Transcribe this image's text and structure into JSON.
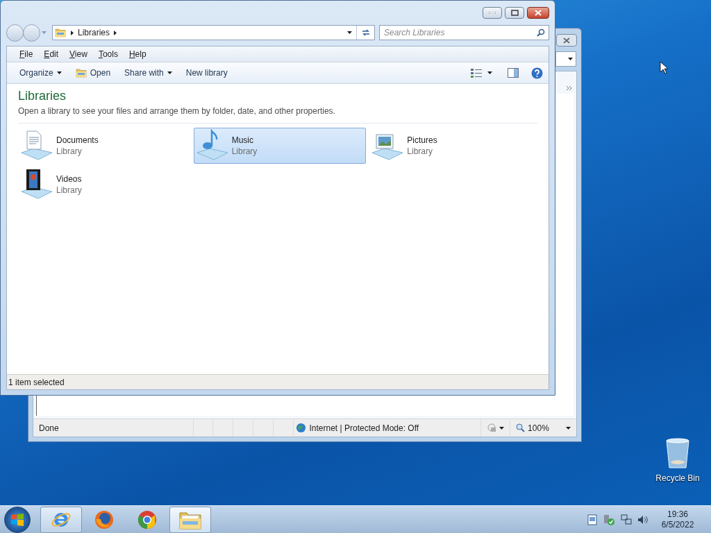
{
  "browser_window": {
    "status": "Done",
    "zone": "Internet | Protected Mode: Off",
    "zoom": "100%"
  },
  "explorer": {
    "breadcrumb": [
      "Libraries"
    ],
    "search": {
      "placeholder": "Search Libraries"
    },
    "menu": [
      {
        "label": "File"
      },
      {
        "label": "Edit"
      },
      {
        "label": "View"
      },
      {
        "label": "Tools"
      },
      {
        "label": "Help"
      }
    ],
    "toolbar": [
      {
        "label": "Organize",
        "kind": "dropdown"
      },
      {
        "label": "Open",
        "kind": "open"
      },
      {
        "label": "Share with",
        "kind": "dropdown"
      },
      {
        "label": "New library",
        "kind": "plain"
      }
    ],
    "heading": "Libraries",
    "description": "Open a library to see your files and arrange them by folder, date, and other properties.",
    "libraries": [
      {
        "name": "Documents",
        "type": "Library",
        "kind": "documents",
        "selected": false
      },
      {
        "name": "Music",
        "type": "Library",
        "kind": "music",
        "selected": true
      },
      {
        "name": "Pictures",
        "type": "Library",
        "kind": "pictures",
        "selected": false
      },
      {
        "name": "Videos",
        "type": "Library",
        "kind": "videos",
        "selected": false
      }
    ],
    "status": "1 item selected"
  },
  "desktop_icons": [
    {
      "label": "Recycle Bin"
    }
  ],
  "taskbar": {
    "apps": [
      {
        "kind": "ie",
        "running": true,
        "selected": false
      },
      {
        "kind": "firefox",
        "running": false,
        "selected": false
      },
      {
        "kind": "chrome",
        "running": false,
        "selected": false
      },
      {
        "kind": "explorer",
        "running": true,
        "selected": true
      }
    ],
    "clock": {
      "time": "19:36",
      "date": "6/5/2022"
    }
  }
}
